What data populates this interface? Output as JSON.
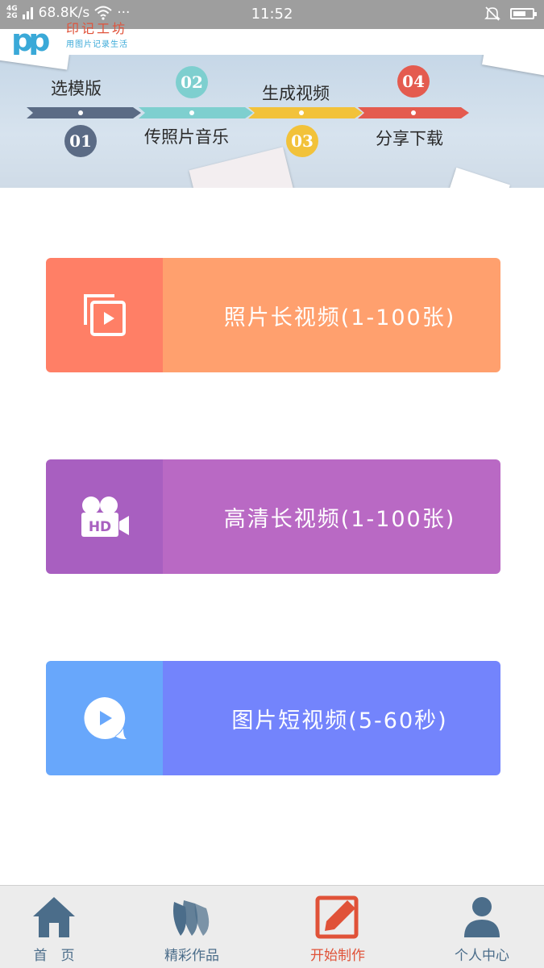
{
  "status_bar": {
    "network_top": "4G",
    "network_bottom": "2G",
    "speed": "68.8K/s",
    "more": "···",
    "time": "11:52",
    "battery_level": 0.7
  },
  "logo": {
    "mark": "pp",
    "title": "印记工坊",
    "subtitle": "用图片记录生活"
  },
  "banner": {
    "steps": [
      {
        "number": "01",
        "label": "选模版",
        "color": "#5b6b85"
      },
      {
        "number": "02",
        "label": "传照片音乐",
        "color": "#7ecfcf"
      },
      {
        "number": "03",
        "label": "生成视频",
        "color": "#f2c23a"
      },
      {
        "number": "04",
        "label": "分享下载",
        "color": "#e45b4f"
      }
    ]
  },
  "cards": [
    {
      "label": "照片长视频(1-100张)",
      "icon": "photo-video-icon",
      "icon_bg": "#ff7f66",
      "label_bg": "#ffa06e"
    },
    {
      "label": "高清长视频(1-100张)",
      "icon": "hd-camera-icon",
      "icon_bg": "#a85fc0",
      "label_bg": "#b969c4"
    },
    {
      "label": "图片短视频(5-60秒)",
      "icon": "play-bubble-icon",
      "icon_bg": "#68a7fb",
      "label_bg": "#7384fc"
    }
  ],
  "tabbar": {
    "tabs": [
      {
        "label": "首　页",
        "icon": "home-icon",
        "active": false
      },
      {
        "label": "精彩作品",
        "icon": "works-icon",
        "active": false
      },
      {
        "label": "开始制作",
        "icon": "edit-icon",
        "active": true
      },
      {
        "label": "个人中心",
        "icon": "user-icon",
        "active": false
      }
    ],
    "inactive_color": "#4b6d8a",
    "active_color": "#e05238"
  }
}
